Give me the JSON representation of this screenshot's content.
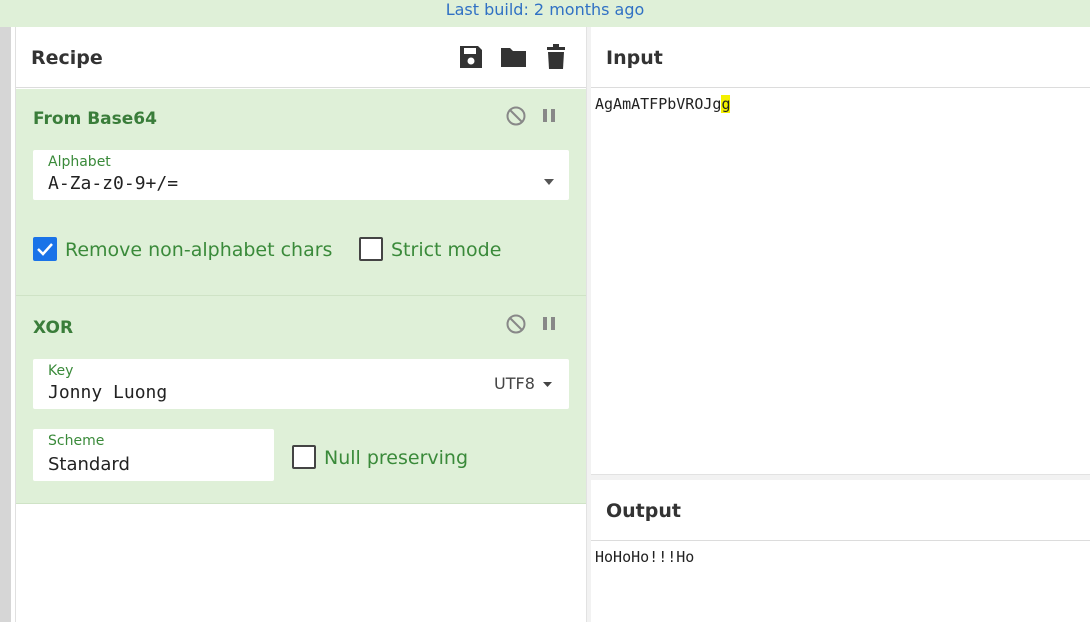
{
  "banner": {
    "text": "Last build: 2 months ago"
  },
  "recipe": {
    "title": "Recipe",
    "toolbar_icons": [
      "save-icon",
      "folder-icon",
      "trash-icon"
    ],
    "operations": [
      {
        "name": "From Base64",
        "alphabet_label": "Alphabet",
        "alphabet_value": "A-Za-z0-9+/=",
        "remove_nonalpha_label": "Remove non-alphabet chars",
        "remove_nonalpha_checked": true,
        "strict_label": "Strict mode",
        "strict_checked": false
      },
      {
        "name": "XOR",
        "key_label": "Key",
        "key_value": "Jonny Luong",
        "key_encoding": "UTF8",
        "scheme_label": "Scheme",
        "scheme_value": "Standard",
        "null_label": "Null preserving",
        "null_checked": false
      }
    ]
  },
  "input": {
    "title": "Input",
    "text_main": "AgAmATFPbVROJg",
    "text_highlight": "g"
  },
  "output": {
    "title": "Output",
    "text": "HoHoHo!!!Ho"
  },
  "colors": {
    "accent_green": "#dff0d8",
    "highlight": "#f4f000",
    "checkbox_blue": "#1a73e8"
  }
}
